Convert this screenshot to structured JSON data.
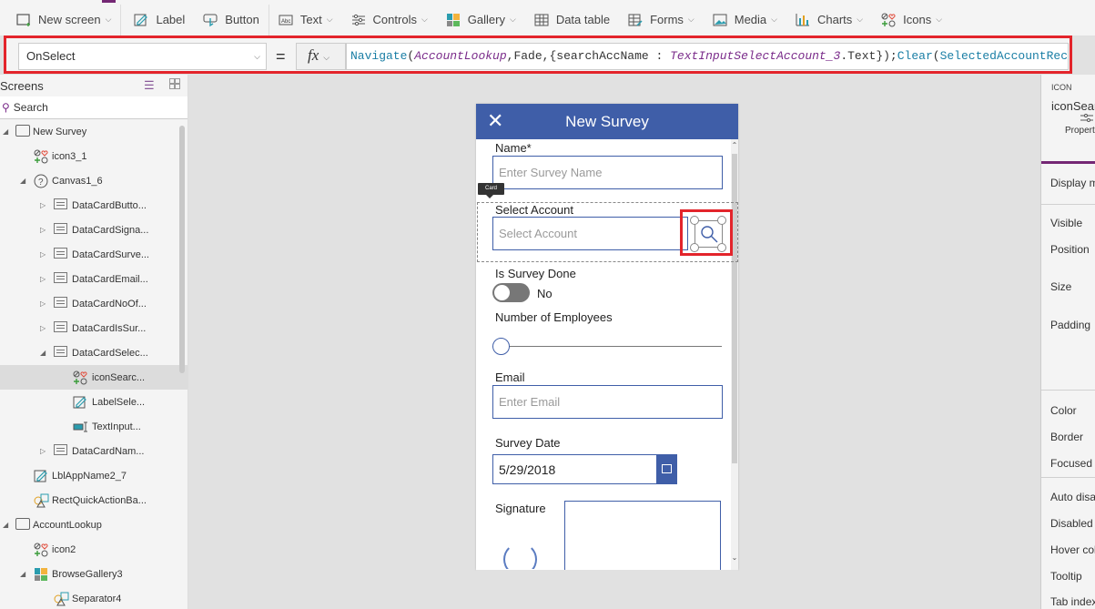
{
  "ribbon": {
    "items": [
      {
        "label": "New screen",
        "icon": "new-screen-icon",
        "dropdown": true
      },
      {
        "label": "Label",
        "icon": "label-icon",
        "dropdown": false
      },
      {
        "label": "Button",
        "icon": "button-icon",
        "dropdown": false
      },
      {
        "label": "Text",
        "icon": "text-icon",
        "dropdown": true
      },
      {
        "label": "Controls",
        "icon": "controls-icon",
        "dropdown": true
      },
      {
        "label": "Gallery",
        "icon": "gallery-icon",
        "dropdown": true
      },
      {
        "label": "Data table",
        "icon": "data-table-icon",
        "dropdown": false
      },
      {
        "label": "Forms",
        "icon": "forms-icon",
        "dropdown": true
      },
      {
        "label": "Media",
        "icon": "media-icon",
        "dropdown": true
      },
      {
        "label": "Charts",
        "icon": "charts-icon",
        "dropdown": true
      },
      {
        "label": "Icons",
        "icon": "icons-icon",
        "dropdown": true
      }
    ],
    "chevron": "⌵"
  },
  "formula_bar": {
    "property": "OnSelect",
    "equals": "=",
    "fx": "fx",
    "tokens": [
      {
        "t": "Navigate",
        "c": "fn"
      },
      {
        "t": "(",
        "c": ""
      },
      {
        "t": "AccountLookup",
        "c": "id"
      },
      {
        "t": ",Fade,{searchAccName : ",
        "c": ""
      },
      {
        "t": "TextInputSelectAccount_3",
        "c": "id"
      },
      {
        "t": ".Text});",
        "c": ""
      },
      {
        "t": "Clear",
        "c": "fn"
      },
      {
        "t": "(",
        "c": ""
      },
      {
        "t": "SelectedAccountRecord",
        "c": "idn"
      },
      {
        "t": " )",
        "c": ""
      }
    ]
  },
  "tree_panel": {
    "title": "Screens",
    "search_placeholder": "Search",
    "nodes": [
      {
        "label": "New Survey",
        "level": 0,
        "icon": "screen",
        "toggle": "expanded"
      },
      {
        "label": "icon3_1",
        "level": 1,
        "icon": "icons",
        "toggle": ""
      },
      {
        "label": "Canvas1_6",
        "level": 1,
        "icon": "unknown",
        "toggle": "expanded"
      },
      {
        "label": "DataCardButto...",
        "level": 2,
        "icon": "card",
        "toggle": "collapsed"
      },
      {
        "label": "DataCardSigna...",
        "level": 2,
        "icon": "card",
        "toggle": "collapsed"
      },
      {
        "label": "DataCardSurve...",
        "level": 2,
        "icon": "card",
        "toggle": "collapsed"
      },
      {
        "label": "DataCardEmail...",
        "level": 2,
        "icon": "card",
        "toggle": "collapsed"
      },
      {
        "label": "DataCardNoOf...",
        "level": 2,
        "icon": "card",
        "toggle": "collapsed"
      },
      {
        "label": "DataCardIsSur...",
        "level": 2,
        "icon": "card",
        "toggle": "collapsed"
      },
      {
        "label": "DataCardSelec...",
        "level": 2,
        "icon": "card",
        "toggle": "expanded"
      },
      {
        "label": "iconSearc...",
        "level": 3,
        "icon": "icons",
        "toggle": "",
        "selected": true
      },
      {
        "label": "LabelSele...",
        "level": 3,
        "icon": "label",
        "toggle": ""
      },
      {
        "label": "TextInput...",
        "level": 3,
        "icon": "textinput",
        "toggle": ""
      },
      {
        "label": "DataCardNam...",
        "level": 2,
        "icon": "card",
        "toggle": "collapsed"
      },
      {
        "label": "LblAppName2_7",
        "level": 1,
        "icon": "label",
        "toggle": ""
      },
      {
        "label": "RectQuickActionBa...",
        "level": 1,
        "icon": "shapes",
        "toggle": ""
      },
      {
        "label": "AccountLookup",
        "level": 0,
        "icon": "screen",
        "toggle": "expanded"
      },
      {
        "label": "icon2",
        "level": 1,
        "icon": "icons",
        "toggle": ""
      },
      {
        "label": "BrowseGallery3",
        "level": 1,
        "icon": "gallery",
        "toggle": "expanded"
      },
      {
        "label": "Separator4",
        "level": 2,
        "icon": "shapes",
        "toggle": ""
      }
    ]
  },
  "app": {
    "header_title": "New Survey",
    "close_glyph": "✕",
    "tooltip": "Card",
    "fields": {
      "name_label": "Name*",
      "name_placeholder": "Enter Survey Name",
      "account_label": "Select Account",
      "account_placeholder": "Select Account",
      "done_label": "Is Survey Done",
      "done_value": "No",
      "done_on": false,
      "employees_label": "Number of Employees",
      "employees_slider_value": 0,
      "email_label": "Email",
      "email_placeholder": "Enter Email",
      "date_label": "Survey Date",
      "date_value": "5/29/2018",
      "signature_label": "Signature"
    }
  },
  "properties_panel": {
    "type": "ICON",
    "name": "iconSear",
    "tab": "Propert",
    "rows": [
      "Display m",
      "Visible",
      "Position",
      "Size",
      "Padding",
      "Color",
      "Border",
      "Focused I",
      "Auto disa",
      "Disabled",
      "Hover col",
      "Tooltip",
      "Tab index"
    ]
  },
  "colors": {
    "accent_purple": "#742774",
    "app_blue": "#3f5ea8",
    "highlight_red": "#e3242b"
  }
}
